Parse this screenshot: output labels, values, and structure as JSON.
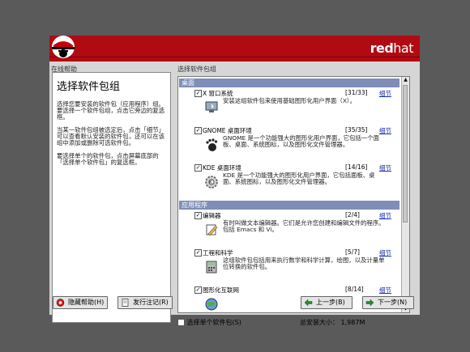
{
  "brand": {
    "bold": "red",
    "thin": "hat"
  },
  "help": {
    "panel_title": "在线帮助",
    "heading": "选择软件包组",
    "paragraphs": [
      "选择您要安装的软件包（应用程序）组。要选择一个软件包组，点击它旁边的复选框。",
      "当某一软件包组被选定后，点击「细节」可以查看默认安装的软件包，还可以在该组中添加或删除可选软件包。",
      "要选择单个的软件包，点击屏幕底部的「选择单个软件包」的复选框。"
    ]
  },
  "packages": {
    "panel_title": "选择软件包组",
    "detail_label": "细节",
    "categories": [
      {
        "label": "桌面",
        "groups": [
          {
            "name": "X 窗口系统",
            "count": "[31/33]",
            "checked": true,
            "icon": "monitor-icon",
            "desc": "安装这组软件包来使用基础图形化用户界面（X）。"
          },
          {
            "name": "GNOME 桌面环境",
            "count": "[35/35]",
            "checked": true,
            "icon": "gnome-foot-icon",
            "desc": "GNOME 是一个功能强大的图形化用户界面，它包括一个面板、桌面、系统图标，以及图形化文件管理器。"
          },
          {
            "name": "KDE 桌面环境",
            "count": "[14/16]",
            "checked": true,
            "icon": "kde-gear-icon",
            "desc": "KDE 是一个功能强大的图形化用户界面，它包括面板、桌面、系统图标，以及图形化文件管理器。"
          }
        ]
      },
      {
        "label": "应用程序",
        "groups": [
          {
            "name": "编辑器",
            "count": "[2/4]",
            "checked": true,
            "icon": "pencil-icon",
            "desc": "有时叫做文本编辑器。它们是允许您创建和编辑文件的程序。包括 Emacs 和 Vi。"
          },
          {
            "name": "工程和科学",
            "count": "[5/7]",
            "checked": true,
            "icon": "calculator-icon",
            "desc": "这组软件包包括用来执行数学和科学计算，绘图，以及计量单位转换的软件包。"
          },
          {
            "name": "图形化互联网",
            "count": "[8/14]",
            "checked": true,
            "icon": "globe-icon",
            "desc": ""
          }
        ]
      }
    ]
  },
  "single_pkg_label": "选择单个软件包(S)",
  "total_size": "总安装大小： 1,987M",
  "buttons": {
    "hide_help": "隐藏帮助(H)",
    "release_notes": "发行注记(R)",
    "back": "上一步(B)",
    "next": "下一步(N)"
  },
  "colors": {
    "banner": "#b00a12",
    "category": "#7f8db8",
    "link": "#1a2fb0"
  }
}
